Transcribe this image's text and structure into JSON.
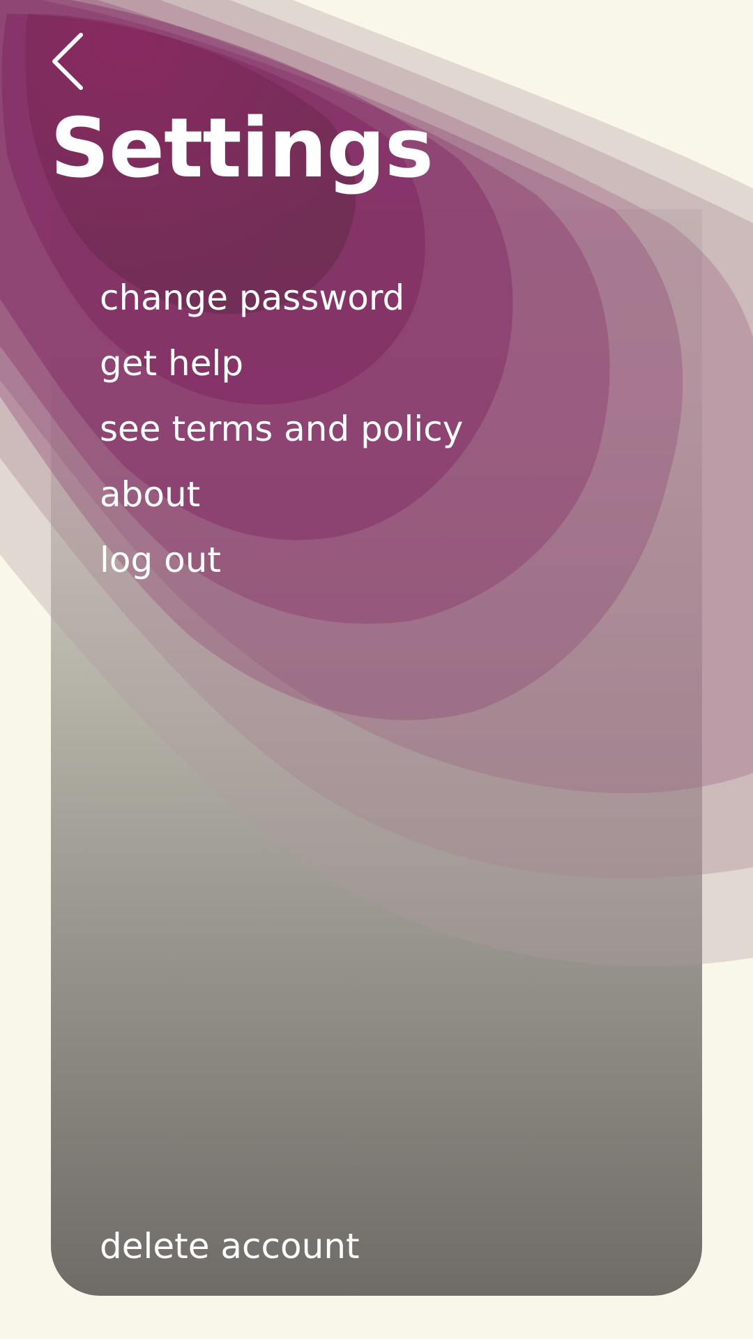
{
  "header": {
    "back_icon": "chevron-left-icon",
    "title": "Settings"
  },
  "menu": {
    "items": [
      {
        "id": "change-password",
        "label": "change password"
      },
      {
        "id": "get-help",
        "label": "get help"
      },
      {
        "id": "terms-policy",
        "label": "see terms and policy"
      },
      {
        "id": "about",
        "label": "about"
      },
      {
        "id": "log-out",
        "label": "log out"
      }
    ]
  },
  "footer": {
    "delete_label": "delete account"
  },
  "colors": {
    "background": "#f9f6ea",
    "accent": "#8a1d58",
    "text": "#ffffff"
  }
}
